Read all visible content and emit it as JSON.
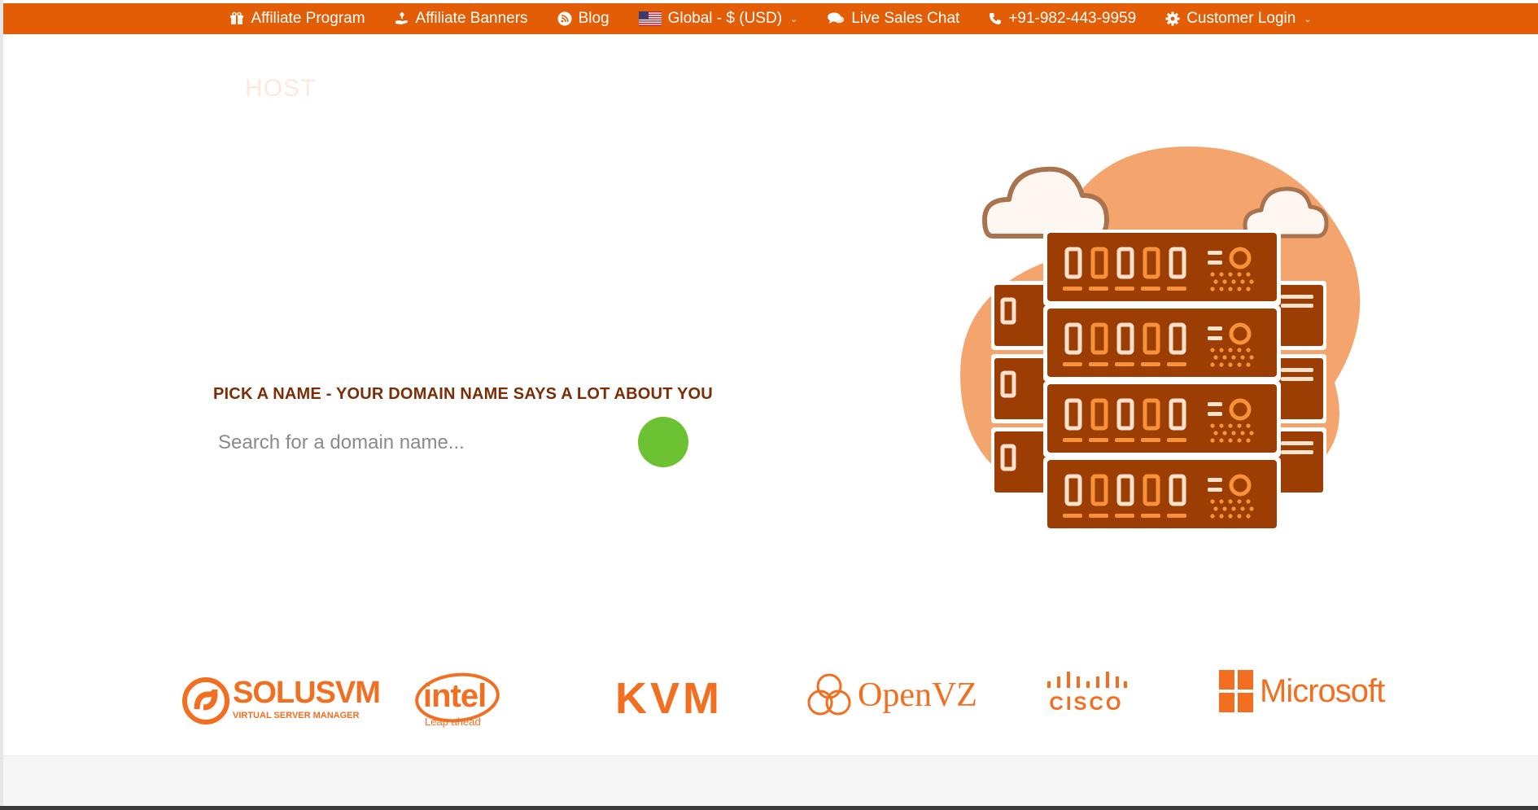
{
  "topbar": {
    "items": [
      {
        "label": "Affiliate Program",
        "icon": "gift-icon"
      },
      {
        "label": "Affiliate Banners",
        "icon": "hand-icon"
      },
      {
        "label": "Blog",
        "icon": "rss-icon"
      },
      {
        "label": "Global - $ (USD)",
        "icon": "us-flag-icon"
      },
      {
        "label": "Live Sales Chat",
        "icon": "chat-icon"
      },
      {
        "label": "+91-982-443-9959",
        "icon": "phone-icon"
      },
      {
        "label": "Customer Login",
        "icon": "gear-icon"
      }
    ]
  },
  "logo": {
    "text": "HOST"
  },
  "hero": {
    "heading": "PICK A NAME - YOUR DOMAIN NAME SAYS A LOT ABOUT YOU",
    "search_placeholder": "Search for a domain name..."
  },
  "partners": {
    "solusvm": {
      "name": "SOLUSVM",
      "tagline": "VIRTUAL SERVER MANAGER"
    },
    "intel": {
      "name": "intel",
      "tagline": "Leap ahead"
    },
    "kvm": {
      "name": "KVM"
    },
    "openvz": {
      "name": "OpenVZ"
    },
    "cisco": {
      "name": "CISCO"
    },
    "microsoft": {
      "name": "Microsoft"
    }
  },
  "colors": {
    "brand_orange": "#e25d05",
    "heading_brown": "#7a2e08",
    "search_button_green": "#6cc233",
    "partner_orange": "#f26f21"
  }
}
